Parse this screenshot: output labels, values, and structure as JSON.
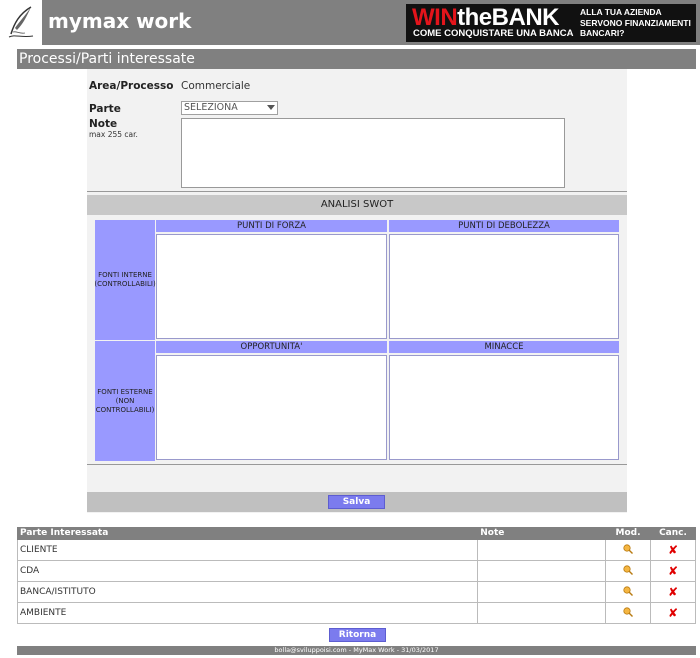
{
  "header": {
    "app_title": "mymax work",
    "banner": {
      "win": "WIN",
      "the_bank": "theBANK",
      "subtitle": "COME CONQUISTARE UNA BANCA",
      "tagline": "ALLA TUA AZIENDA SERVONO FINANZIAMENTI BANCARI?"
    }
  },
  "page": {
    "section_title": "Processi/Parti interessate"
  },
  "form": {
    "area_label": "Area/Processo",
    "area_value": "Commerciale",
    "parte_label": "Parte",
    "parte_selected": "SELEZIONA",
    "note_label": "Note",
    "note_hint": "max 255 car.",
    "note_value": ""
  },
  "swot": {
    "title": "ANALISI SWOT",
    "internal_label": "FONTI INTERNE (CONTROLLABILI)",
    "external_label": "FONTI ESTERNE (NON CONTROLLABILI)",
    "strengths": "PUNTI DI FORZA",
    "weaknesses": "PUNTI DI DEBOLEZZA",
    "opportunities": "OPPORTUNITA'",
    "threats": "MINACCE",
    "save_button": "Salva"
  },
  "table": {
    "headers": {
      "party": "Parte Interessata",
      "note": "Note",
      "edit": "Mod.",
      "delete": "Canc."
    },
    "rows": [
      {
        "party": "CLIENTE",
        "note": ""
      },
      {
        "party": "CDA",
        "note": ""
      },
      {
        "party": "BANCA/ISTITUTO",
        "note": ""
      },
      {
        "party": "AMBIENTE",
        "note": ""
      }
    ],
    "delete_glyph": "✘"
  },
  "back_button": "Ritorna",
  "footer": "bolla@sviluppoisi.com - MyMax Work - 31/03/2017",
  "colors": {
    "header_gray": "#808080",
    "swot_blue": "#9999ff",
    "button_blue": "#7b7bee",
    "delete_red": "#e00000"
  },
  "icons": [
    "logo-quill-icon",
    "edit-pencil-icon",
    "delete-x-icon",
    "chevron-down-icon"
  ]
}
